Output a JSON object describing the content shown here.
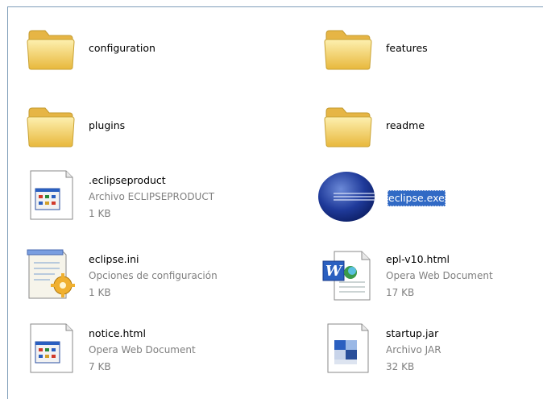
{
  "items": [
    {
      "name": "configuration",
      "type": "folder"
    },
    {
      "name": "features",
      "type": "folder"
    },
    {
      "name": "plugins",
      "type": "folder"
    },
    {
      "name": "readme",
      "type": "folder"
    },
    {
      "name": ".eclipseproduct",
      "kind": "Archivo ECLIPSEPRODUCT",
      "size": "1 KB",
      "icon": "generic-window-file-icon"
    },
    {
      "name": "eclipse.exe",
      "icon": "eclipse-app-icon",
      "selected": true
    },
    {
      "name": "eclipse.ini",
      "kind": "Opciones de configuración",
      "size": "1 KB",
      "icon": "config-file-icon"
    },
    {
      "name": "epl-v10.html",
      "kind": "Opera Web Document",
      "size": "17 KB",
      "icon": "word-document-icon"
    },
    {
      "name": "notice.html",
      "kind": "Opera Web Document",
      "size": "7 KB",
      "icon": "generic-window-file-icon"
    },
    {
      "name": "startup.jar",
      "kind": "Archivo JAR",
      "size": "32 KB",
      "icon": "jar-file-icon"
    }
  ],
  "colors": {
    "selection": "#316ac5",
    "folder": "#f7d66a",
    "subtext": "#808080"
  }
}
